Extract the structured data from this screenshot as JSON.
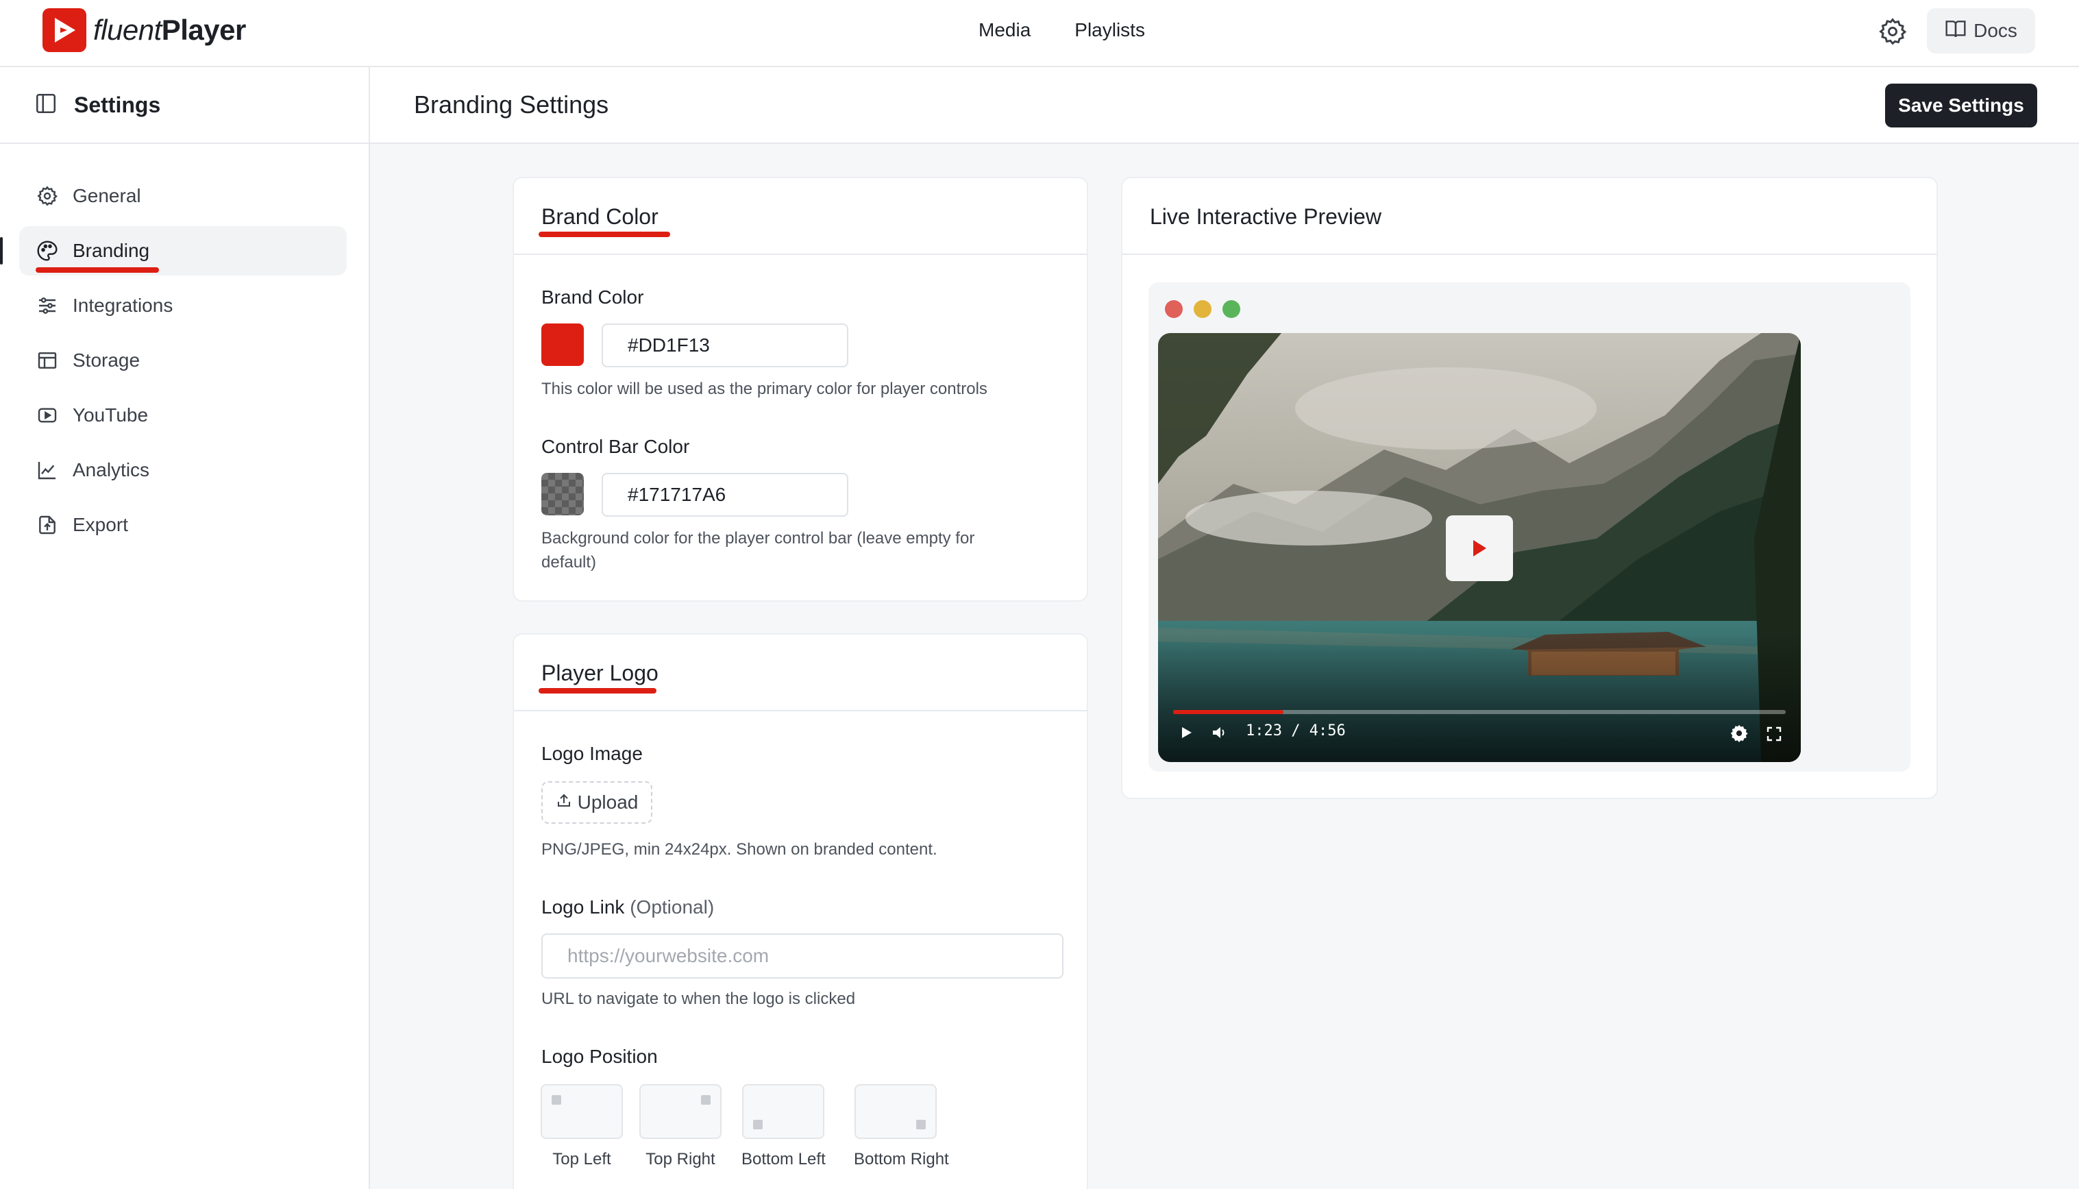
{
  "app": {
    "name_light": "fluent",
    "name_bold": "Player"
  },
  "topnav": {
    "items": [
      "Media",
      "Playlists"
    ],
    "docs_label": "Docs"
  },
  "sidebar": {
    "title": "Settings",
    "items": [
      {
        "label": "General",
        "icon": "gear-icon"
      },
      {
        "label": "Branding",
        "icon": "palette-icon",
        "active": true
      },
      {
        "label": "Integrations",
        "icon": "sliders-icon"
      },
      {
        "label": "Storage",
        "icon": "storage-icon"
      },
      {
        "label": "YouTube",
        "icon": "youtube-icon"
      },
      {
        "label": "Analytics",
        "icon": "chart-icon"
      },
      {
        "label": "Export",
        "icon": "export-icon"
      }
    ]
  },
  "header": {
    "title": "Branding Settings",
    "save_label": "Save Settings"
  },
  "brand_card": {
    "title": "Brand Color",
    "brand_color": {
      "label": "Brand Color",
      "value": "#DD1F13",
      "help": "This color will be used as the primary color for player controls"
    },
    "control_bar": {
      "label": "Control Bar Color",
      "value": "#171717A6",
      "help_line1": "Background color for the player control bar (leave empty for",
      "help_line2": "default)"
    }
  },
  "logo_card": {
    "title": "Player Logo",
    "logo_image": {
      "label": "Logo Image",
      "upload_label": "Upload",
      "help": "PNG/JPEG, min 24x24px. Shown on branded content."
    },
    "logo_link": {
      "label": "Logo Link",
      "optional": "(Optional)",
      "placeholder": "https://yourwebsite.com",
      "help": "URL to navigate to when the logo is clicked"
    },
    "logo_position": {
      "label": "Logo Position",
      "options": [
        "Top Left",
        "Top Right",
        "Bottom Left",
        "Bottom Right"
      ]
    }
  },
  "preview_card": {
    "title": "Live Interactive Preview",
    "time_display": "1:23 / 4:56",
    "progress": 0.18
  },
  "colors": {
    "brand": "#DD1F13",
    "dark": "#1D2127",
    "traffic_red": "#E0605A",
    "traffic_yellow": "#E2B43C",
    "traffic_green": "#5AB55A"
  }
}
